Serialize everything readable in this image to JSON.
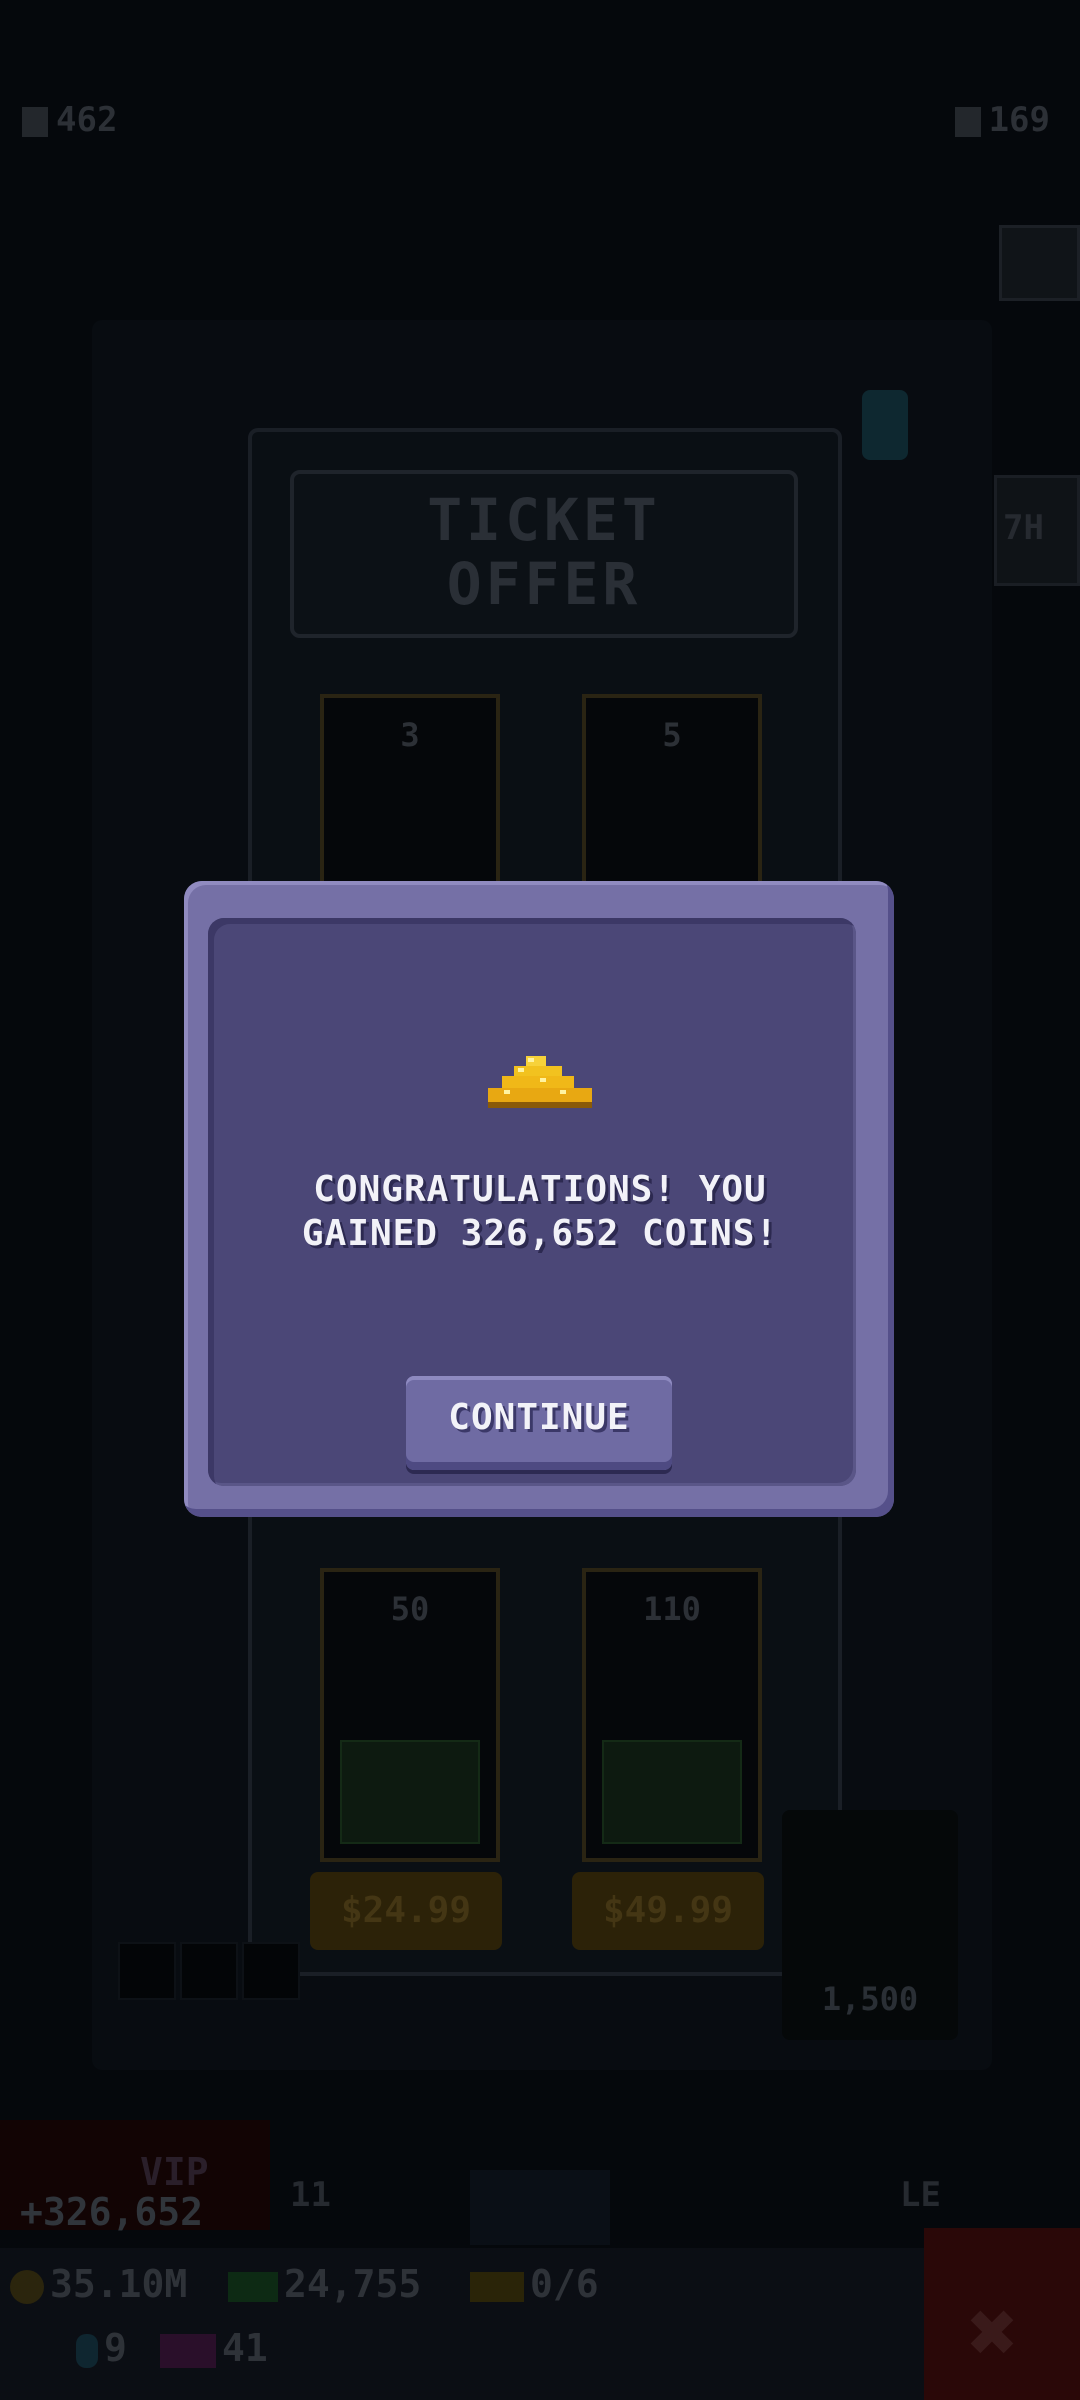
{
  "top_bar": {
    "left_counter": "462",
    "right_counter": "169"
  },
  "side_labels": {
    "timer_fragment": "7H"
  },
  "ticket_offer": {
    "title_line1": "TICKET",
    "title_line2": "OFFER",
    "cards": [
      {
        "qty": "3"
      },
      {
        "qty": "5"
      },
      {
        "qty": "50",
        "price": "$24.99"
      },
      {
        "qty": "110",
        "price": "$49.99"
      }
    ],
    "side_badge_value": "1,500"
  },
  "dimmed_lower": {
    "vip_label": "VIP",
    "gained_label": "+326,652",
    "mid_label": "11",
    "right_label": "LE"
  },
  "bottom_bar": {
    "coins": "35.10M",
    "cash": "24,755",
    "tickets": "0/6",
    "gems": "9",
    "tv": "41"
  },
  "modal": {
    "message_line1": "CONGRATULATIONS! YOU",
    "message_line2": "GAINED 326,652 COINS!",
    "continue_label": "CONTINUE",
    "icon": "coin-pile-icon"
  },
  "colors": {
    "modal_frame": "#7570a6",
    "modal_body": "#4b4777",
    "button": "#6f6ba3",
    "gold": "#f2c21f"
  }
}
